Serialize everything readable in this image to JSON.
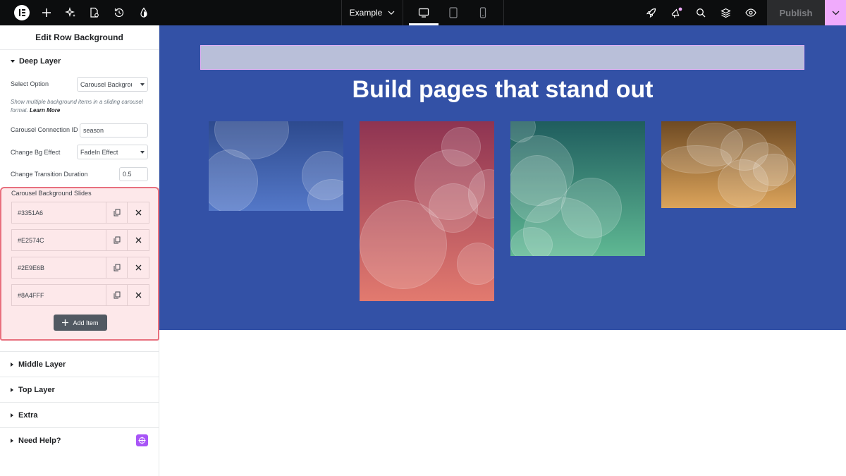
{
  "topbar": {
    "site_selector": "Example",
    "publish_label": "Publish",
    "icons": [
      "elementor-logo-icon",
      "add-icon",
      "ai-sparkle-icon",
      "page-settings-icon",
      "history-icon",
      "theme-style-icon",
      "desktop-icon",
      "tablet-icon",
      "mobile-icon",
      "rocket-icon",
      "announcement-icon",
      "search-icon",
      "layers-icon",
      "preview-eye-icon",
      "chevron-down-icon"
    ]
  },
  "panel": {
    "title": "Edit Row Background",
    "deep_layer": {
      "title": "Deep Layer",
      "select_option_label": "Select Option",
      "select_option_value": "Carousel Background",
      "description": "Show multiple background items in a sliding carousel format.",
      "learn_more": "Learn More",
      "connection_id_label": "Carousel Connection ID",
      "connection_id_value": "season",
      "bg_effect_label": "Change Bg Effect",
      "bg_effect_value": "FadeIn Effect",
      "transition_label": "Change Transition Duration",
      "transition_value": "0.5",
      "slides_label": "Carousel Background Slides",
      "slides": [
        "#3351A6",
        "#E2574C",
        "#2E9E6B",
        "#8A4FFF"
      ],
      "add_item_label": "Add Item"
    },
    "middle_layer": "Middle Layer",
    "top_layer": "Top Layer",
    "extra": "Extra",
    "need_help": "Need Help?"
  },
  "canvas": {
    "heading": "Build pages that stand out",
    "hero_color": "#3351a6"
  }
}
